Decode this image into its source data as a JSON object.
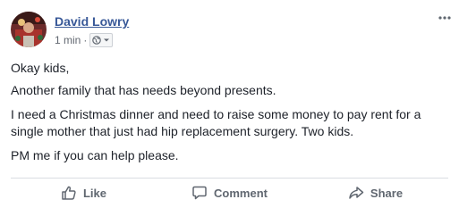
{
  "post": {
    "author": "David Lowry",
    "timestamp": "1 min",
    "separator": "·",
    "paragraphs": [
      "Okay kids,",
      "Another family that has needs beyond presents.",
      "I need a Christmas dinner and need to raise some money to pay rent for a single mother that just had hip replacement surgery. Two kids.",
      "PM me if you can help please."
    ]
  },
  "menu": {
    "icon": "more-options-icon"
  },
  "actions": {
    "like": "Like",
    "comment": "Comment",
    "share": "Share"
  },
  "colors": {
    "author_link": "#385898",
    "meta_text": "#616770",
    "action_text": "#606770",
    "divider": "#dadde1"
  }
}
